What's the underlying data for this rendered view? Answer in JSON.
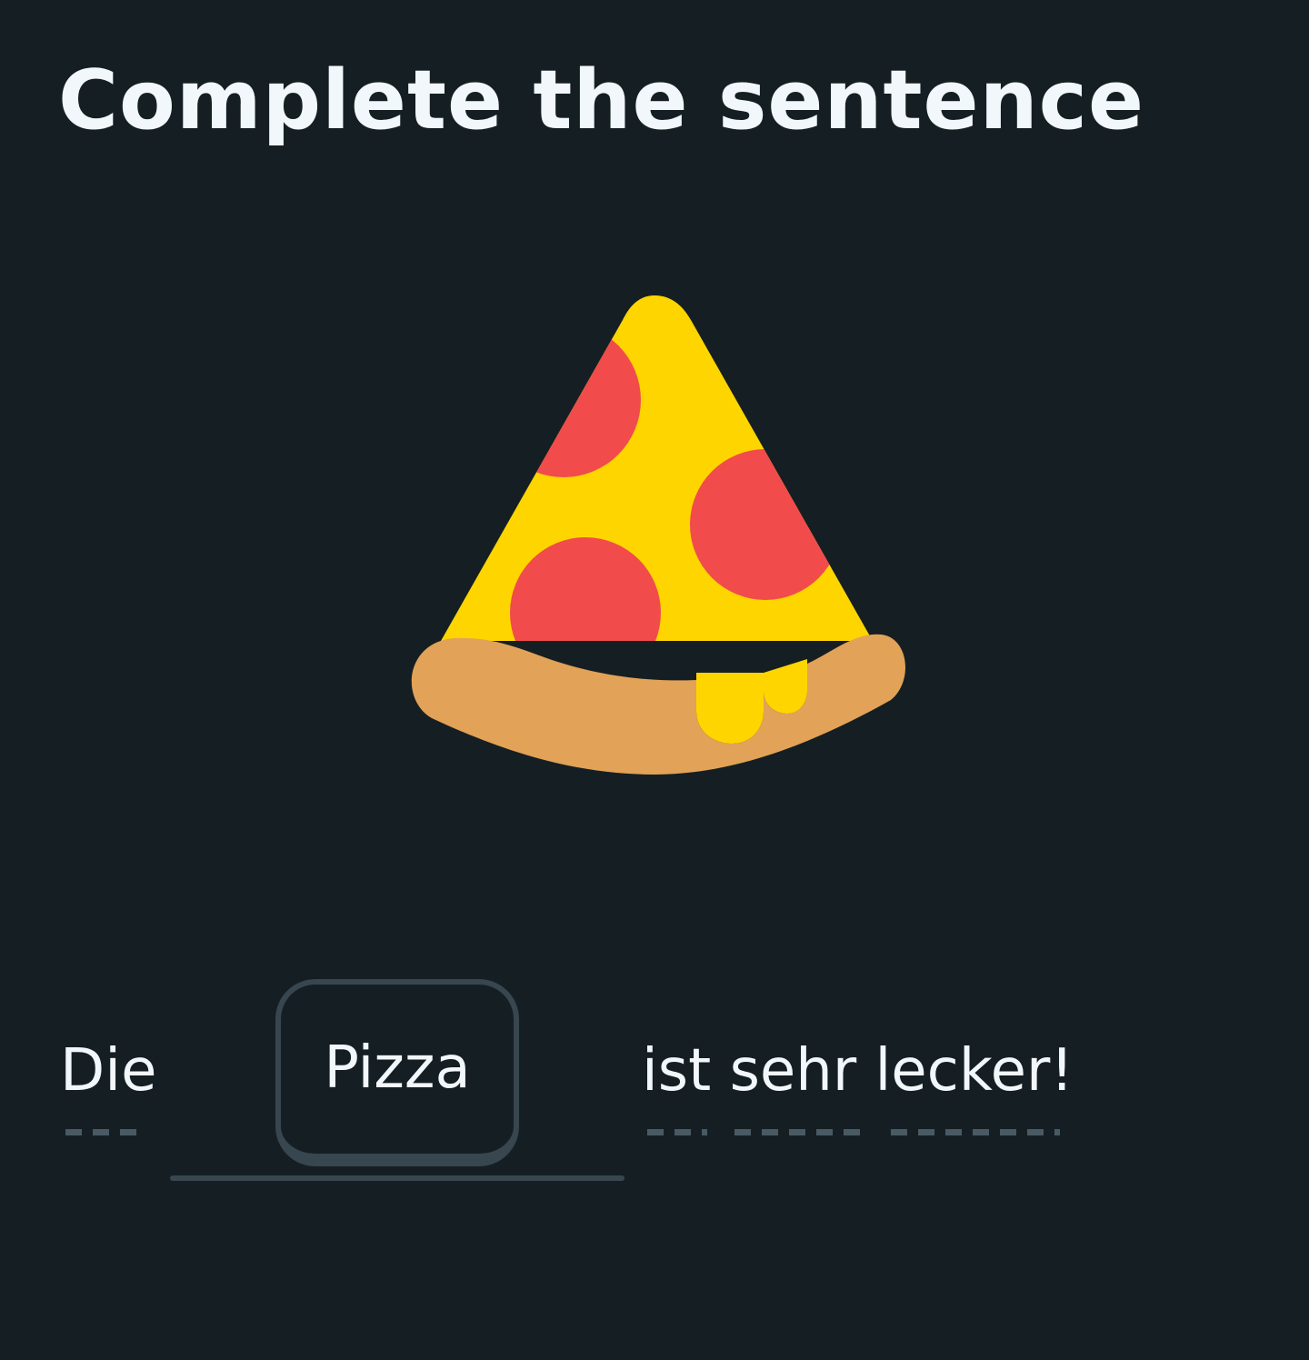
{
  "title": "Complete the sentence",
  "illustration": {
    "icon": "pizza-slice-icon",
    "colors": {
      "cheese": "#ffd500",
      "pepperoni": "#f24b4b",
      "crust": "#e2a257"
    }
  },
  "sentence": {
    "before": "Die",
    "choice": "Pizza",
    "after": "ist sehr lecker!"
  },
  "colors": {
    "background": "#151f23",
    "text": "#f1f7fb",
    "border": "#37464f"
  }
}
